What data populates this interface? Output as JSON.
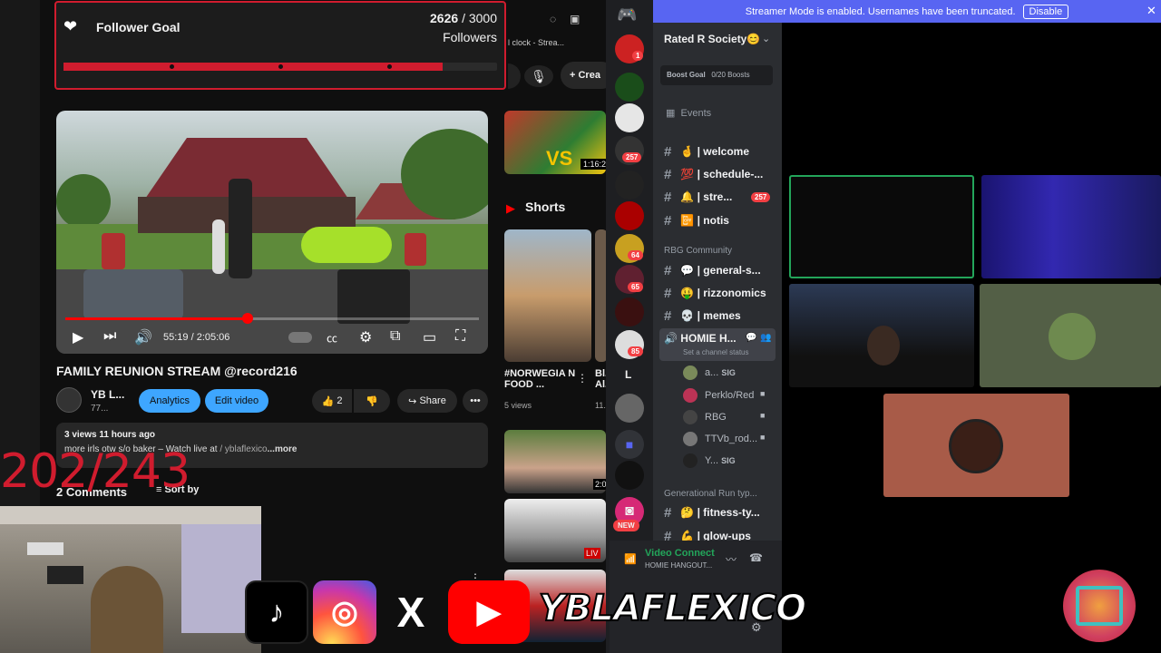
{
  "follower_goal": {
    "title": "Follower Goal",
    "current": "2626",
    "separator": "/",
    "target": "3000",
    "unit": "Followers",
    "progress": 0.875
  },
  "counter_overlay": "202/243",
  "youtube": {
    "tab_title": "l clock - Strea...",
    "create_label": "Crea",
    "video": {
      "time": "55:19 / 2:05:06",
      "progress": 0.44
    },
    "title": "FAMILY REUNION STREAM @record216",
    "channel_name": "YB L...",
    "channel_subs": "77...",
    "analytics_label": "Analytics",
    "edit_label": "Edit video",
    "likes": "2",
    "share_label": "Share",
    "more_label": "•••",
    "description": {
      "stats": "3 views  11 hours ago",
      "text": "more irls otw s/o baker  – Watch live at",
      "link": "/ yblaflexico",
      "more": "...more"
    },
    "comments_label": "2 Comments",
    "sort_label": "Sort by",
    "side": {
      "top_thumb_badge": "1:16:2",
      "shorts_label": "Shorts",
      "shorts": [
        {
          "title": "#NORWEGIA N FOOD ...",
          "views": "5 views"
        },
        {
          "title": "Bl... Al...",
          "views": "11..."
        }
      ],
      "thumb_badge_2": "2:0",
      "live_badge": "LIV"
    }
  },
  "discord": {
    "banner_text": "Streamer Mode is enabled. Usernames have been truncated.",
    "banner_button": "Disable",
    "server_name": "Rated R Society😊",
    "boost_goal": "Boost Goal",
    "boost_count": "0/20 Boosts",
    "events_label": "Events",
    "channels": [
      {
        "name": "🤞 | welcome"
      },
      {
        "name": "💯 | schedule-..."
      },
      {
        "name": "🔔 | stre...",
        "badge": "257"
      },
      {
        "name": "📴 | notis"
      }
    ],
    "category_community": "RBG Community",
    "community_channels": [
      {
        "name": "💬 | general-s..."
      },
      {
        "name": "🤑 | rizzonomics"
      },
      {
        "name": "💀 | memes"
      }
    ],
    "voice_channel": "HOMIE H...",
    "voice_status": "Set a channel status",
    "voice_users": [
      {
        "name": "a...",
        "tag": "SIG"
      },
      {
        "name": "Perklo/Red"
      },
      {
        "name": "RBG"
      },
      {
        "name": "TTVb_rod..."
      },
      {
        "name": "Y...",
        "tag": "SIG"
      }
    ],
    "category_gen": "Generational Run typ...",
    "gen_channels": [
      {
        "name": "🤔 | fitness-ty..."
      },
      {
        "name": "💪 | glow-ups"
      }
    ],
    "server_badges": [
      "1",
      "257",
      "64",
      "65",
      "85"
    ],
    "server_letter": "L",
    "new_label": "NEW",
    "video_connected": "Video Connect",
    "video_sub": "HOMIE HANGOUT..."
  },
  "socials": {
    "handle": "YBLAFLEXICO",
    "x_label": "X"
  }
}
